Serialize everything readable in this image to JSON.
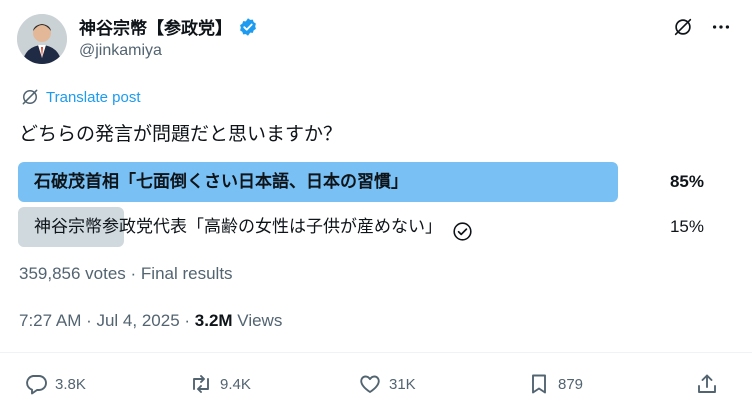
{
  "post": {
    "author_name": "神谷宗幣【参政党】",
    "handle": "@jinkamiya",
    "translate_label": "Translate post",
    "question": "どちらの発言が問題だと思いますか？"
  },
  "poll": {
    "options": [
      {
        "label": "石破茂首相「七面倒くさい日本語、日本の習慣」",
        "percent": "85%",
        "fraction": 0.85,
        "leading": true
      },
      {
        "label": "神谷宗幣参政党代表「高齢の女性は子供が産めない」",
        "percent": "15%",
        "fraction": 0.15,
        "leading": false,
        "voted": true
      }
    ],
    "votes_text": "359,856 votes · Final results"
  },
  "timestamp": {
    "time_date": "7:27 AM · Jul 4, 2025 · ",
    "views_count": "3.2M",
    "views_label": " Views"
  },
  "actions": {
    "replies": "3.8K",
    "reposts": "9.4K",
    "likes": "31K",
    "bookmarks": "879"
  },
  "colors": {
    "leading_bar": "#79c0f4",
    "other_bar": "#cfd9de",
    "accent": "#1d9bf0",
    "muted_text": "#536471"
  }
}
